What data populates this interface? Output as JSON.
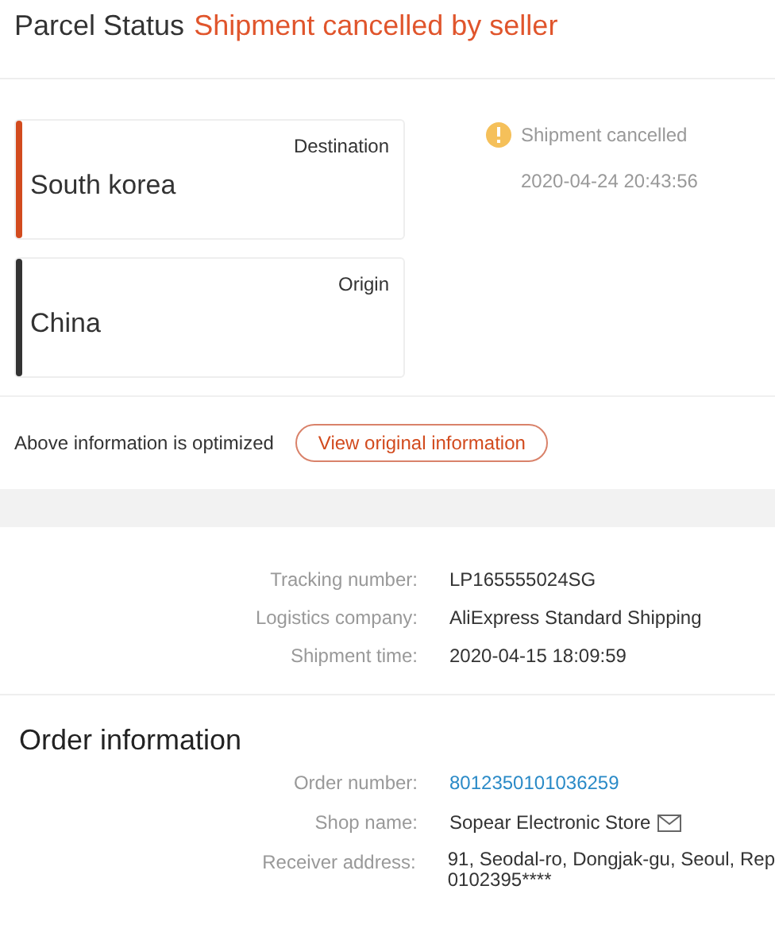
{
  "header": {
    "title": "Parcel Status",
    "status": "Shipment cancelled by seller"
  },
  "locations": [
    {
      "label": "Destination",
      "place": "South korea",
      "color": "#d24b1e"
    },
    {
      "label": "Origin",
      "place": "China",
      "color": "#333333"
    }
  ],
  "event": {
    "text": "Shipment cancelled",
    "time": "2020-04-24 20:43:56"
  },
  "notice": {
    "text": "Above information is optimized",
    "button": "View original information"
  },
  "shipping": [
    {
      "label": "Tracking number:",
      "value": "LP165555024SG"
    },
    {
      "label": "Logistics company:",
      "value": "AliExpress Standard Shipping"
    },
    {
      "label": "Shipment time:",
      "value": "2020-04-15 18:09:59"
    }
  ],
  "order": {
    "title": "Order information",
    "rows": [
      {
        "kind": "link",
        "label": "Order number:",
        "value": "8012350101036259"
      },
      {
        "kind": "shop",
        "label": "Shop name:",
        "value": "Sopear Electronic Store"
      },
      {
        "kind": "text",
        "label": "Receiver address:",
        "value": "91, Seodal-ro, Dongjak-gu, Seoul, Rep",
        "extra": "0102395****"
      }
    ]
  }
}
